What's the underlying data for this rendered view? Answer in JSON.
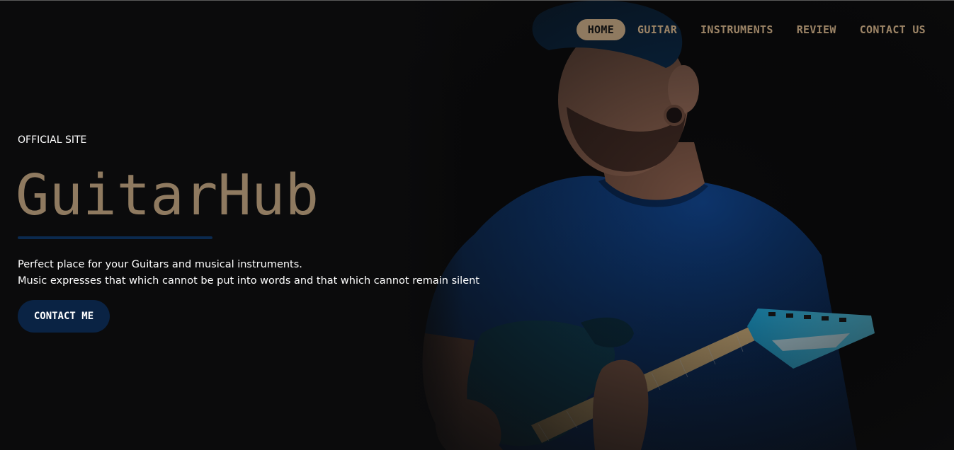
{
  "nav": {
    "items": [
      {
        "label": "HOME",
        "active": true
      },
      {
        "label": "GUITAR",
        "active": false
      },
      {
        "label": "INSTRUMENTS",
        "active": false
      },
      {
        "label": "REVIEW",
        "active": false
      },
      {
        "label": "CONTACT US",
        "active": false
      }
    ]
  },
  "hero": {
    "eyebrow": "OFFICIAL SITE",
    "title": "GuitarHub",
    "tagline_line1": "Perfect place for your Guitars and musical instruments.",
    "tagline_line2": "Music expresses that which cannot be put into words and that which cannot remain silent",
    "cta_label": "CONTACT ME"
  },
  "colors": {
    "background": "#0b0b0c",
    "accent": "#8f7a60",
    "navy": "#0a2344",
    "nav_text": "#9c8466"
  },
  "image": {
    "subject": "guitarist-photo"
  }
}
